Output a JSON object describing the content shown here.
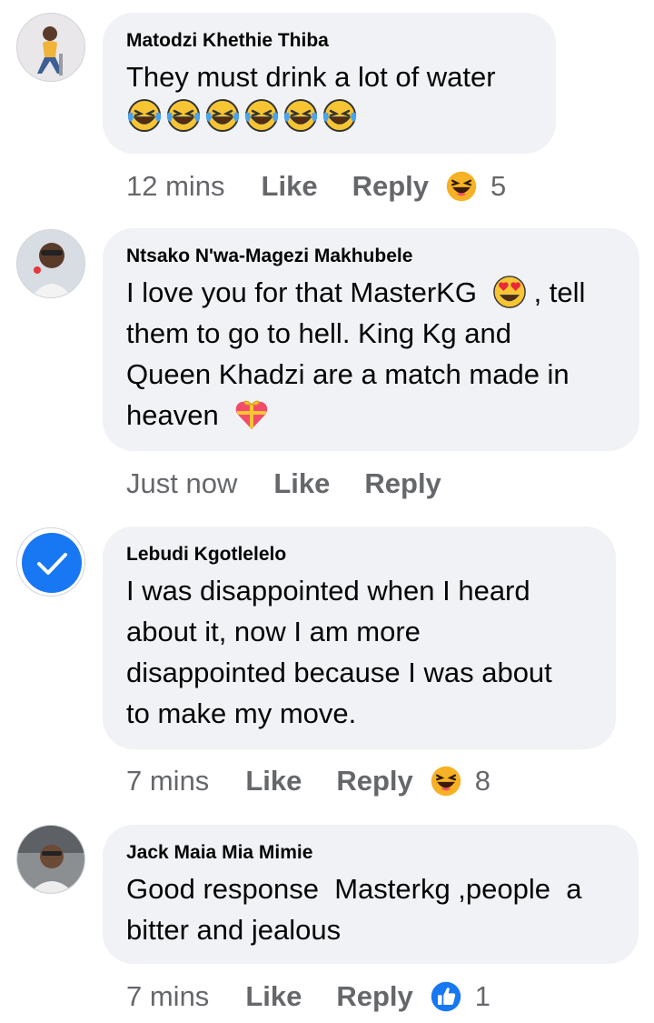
{
  "comments": [
    {
      "author": "Matodzi Khethie Thiba",
      "text": "They must drink a lot of water",
      "emoji_row": "laughing-crying-emoji x6",
      "time": "12 mins",
      "like": "Like",
      "reply": "Reply",
      "reaction_icon": "haha-reaction-icon",
      "reaction_count": "5"
    },
    {
      "author": "Ntsako N'wa-Magezi Makhubele",
      "text_line1a": "I love you for that MasterKG",
      "text_line1b": ", tell",
      "text_line2": "them to go to hell. King Kg and",
      "text_line3": "Queen Khadzi are a match made in",
      "text_line4": "heaven",
      "time": "Just now",
      "like": "Like",
      "reply": "Reply"
    },
    {
      "author": "Lebudi Kgotlelelo",
      "text_line1": "I was disappointed when I heard",
      "text_line2": "about it, now I am more",
      "text_line3": "disappointed because I was about",
      "text_line4": "to make my move.",
      "time": "7 mins",
      "like": "Like",
      "reply": "Reply",
      "reaction_icon": "haha-reaction-icon",
      "reaction_count": "8"
    },
    {
      "author": "Jack Maia Mia Mimie",
      "text_line1": "Good response  Masterkg ,people  a",
      "text_line2": "bitter and jealous",
      "time": "7 mins",
      "like": "Like",
      "reply": "Reply",
      "reaction_icon": "like-reaction-icon",
      "reaction_count": "1"
    }
  ],
  "colors": {
    "bubble": "#f0f2f5",
    "meta": "#65676b",
    "like_blue": "#1877f2",
    "emoji_yellow": "#f7b125"
  }
}
